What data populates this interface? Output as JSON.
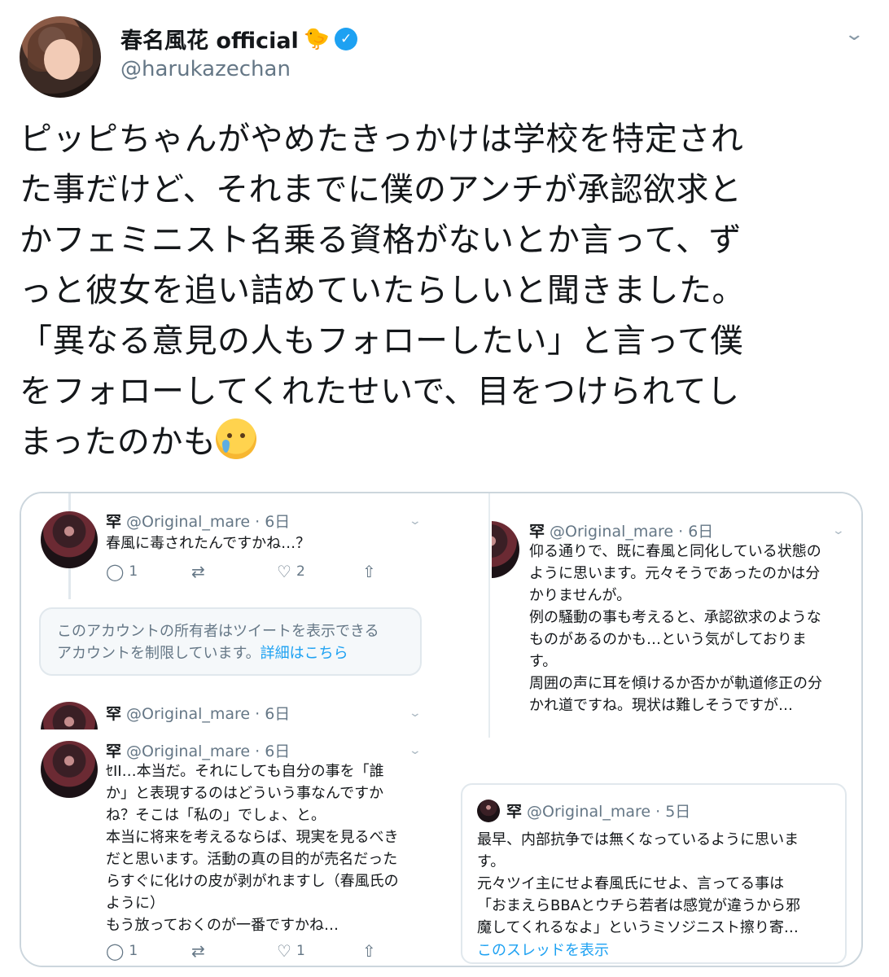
{
  "header": {
    "display_name": "春名風花 official",
    "handle": "@harukazechan",
    "chick_emoji": "🐤",
    "verified": "✓"
  },
  "tweet": {
    "lines": [
      "ピッピちゃんがやめたきっかけは学校を特定され",
      "た事だけど、それまでに僕のアンチが承認欲求と",
      "かフェミニスト名乗る資格がないとか言って、ず",
      "っと彼女を追い詰めていたらしいと聞きました。",
      "「異なる意見の人もフォローしたい」と言って僕",
      "をフォローしてくれたせいで、目をつけられてし",
      "まったのかも"
    ],
    "emoji": "crying-face"
  },
  "screenshots": {
    "top_left": {
      "name_mark": "罕",
      "meta": "@Original_mare · 6日",
      "body": [
        "春風に毒されたんですかね…？"
      ],
      "replies": "1",
      "likes": "2",
      "notice": [
        "このアカウントの所有者はツイートを表示できる",
        "アカウントを制限しています。"
      ],
      "notice_link": "詳細はこちら",
      "second_meta": "@Original_mare · 6日"
    },
    "top_right": {
      "name_mark": "罕",
      "meta": "@Original_mare · 6日",
      "body": [
        "仰る通りで、既に春風と同化している状態の",
        "ように思います。元々そうであったのかは分",
        "かりませんが。",
        "例の騒動の事も考えると、承認欲求のような",
        "ものがあるのかも…という気がしておりま",
        "す。",
        "周囲の声に耳を傾けるか否かが軌道修正の分",
        "かれ道ですね。現状は難しそうですが…"
      ]
    },
    "bottom_left": {
      "name_mark": "罕",
      "meta": "@Original_mare · 6日",
      "body": [
        "ｾII…本当だ。それにしても自分の事を「誰",
        "か」と表現するのはどういう事なんですか",
        "ね？そこは「私の」でしょ、と。",
        "本当に将来を考えるならば、現実を見るべき",
        "だと思います。活動の真の目的が売名だった",
        "らすぐに化けの皮が剥がれますし（春風氏の",
        "ように）",
        "もう放っておくのが一番ですかね…"
      ],
      "replies": "1",
      "likes": "1"
    },
    "bottom_right": {
      "name_mark": "罕",
      "meta": "@Original_mare · 5日",
      "body": [
        "最早、内部抗争では無くなっているように思いま",
        "す。",
        "元々ツイ主にせよ春風氏にせよ、言ってる事は",
        "「おまえらBBAとウチら若者は感覚が違うから邪",
        "魔してくれるなよ」というミソジニスト擦り寄…"
      ],
      "thread_link": "このスレッドを表示"
    }
  },
  "colors": {
    "accent": "#1da1f2",
    "secondary_text": "#657786",
    "border": "#ccd6dd"
  }
}
